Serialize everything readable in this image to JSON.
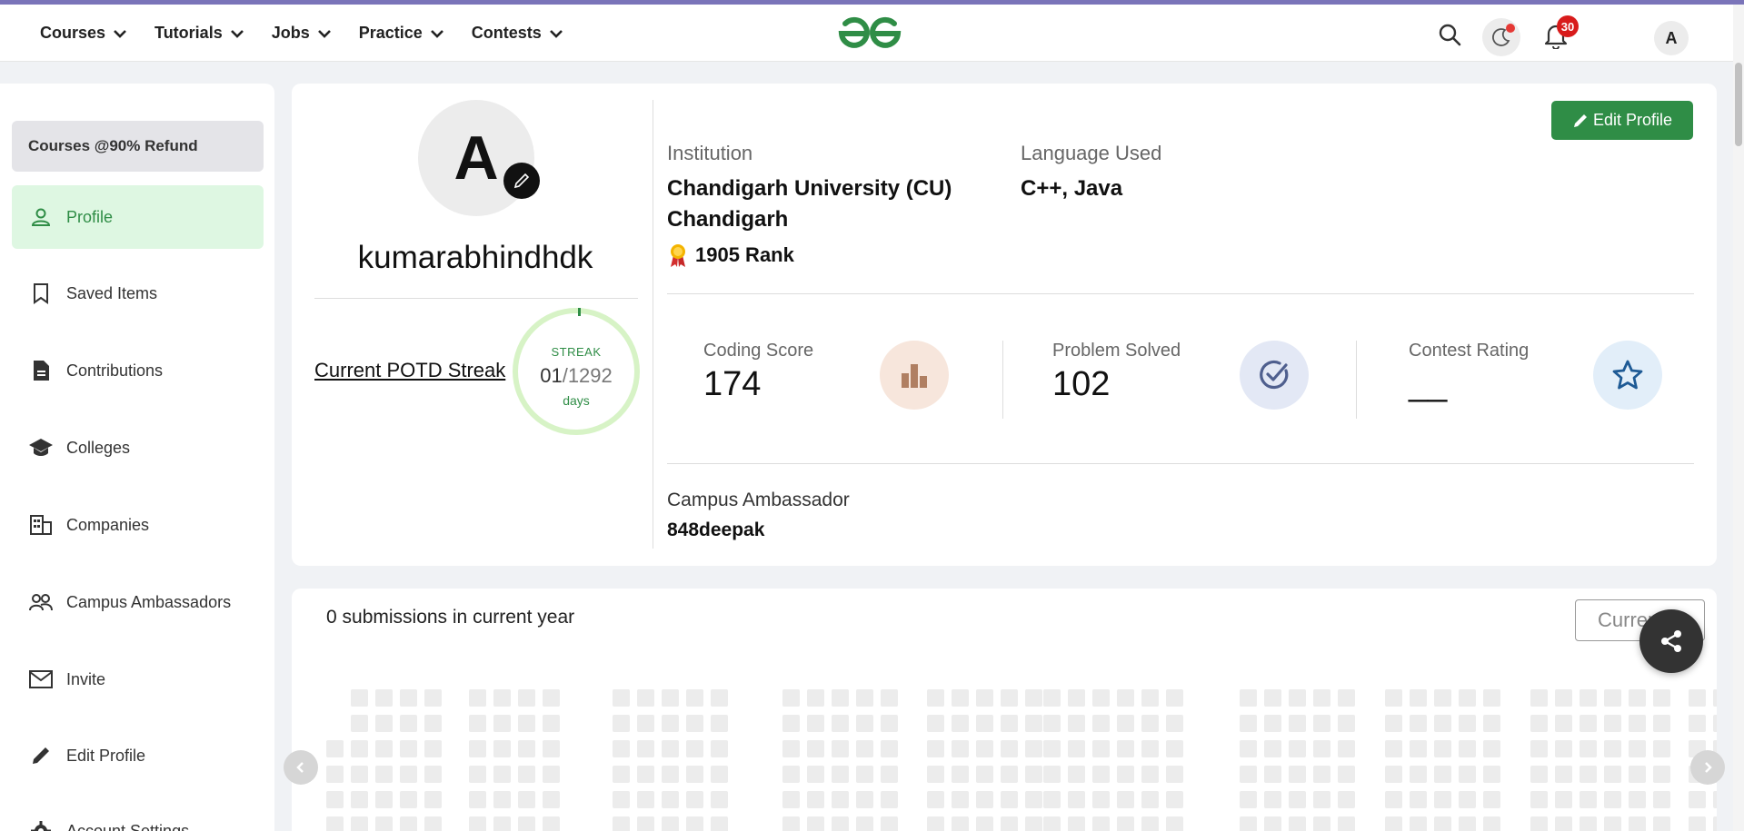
{
  "nav": {
    "menu": [
      {
        "label": "Courses"
      },
      {
        "label": "Tutorials"
      },
      {
        "label": "Jobs"
      },
      {
        "label": "Practice"
      },
      {
        "label": "Contests"
      }
    ],
    "notification_count": "30",
    "avatar_letter": "A"
  },
  "sidebar": {
    "refund_label": "Courses @90% Refund",
    "items": [
      {
        "label": "Profile",
        "icon": "person-icon",
        "active": true
      },
      {
        "label": "Saved Items",
        "icon": "bookmark-icon"
      },
      {
        "label": "Contributions",
        "icon": "document-icon"
      },
      {
        "label": "Colleges",
        "icon": "graduation-cap-icon"
      },
      {
        "label": "Companies",
        "icon": "building-icon"
      },
      {
        "label": "Campus Ambassadors",
        "icon": "group-icon"
      },
      {
        "label": "Invite",
        "icon": "mail-icon"
      },
      {
        "label": "Edit Profile",
        "icon": "pencil-icon"
      },
      {
        "label": "Account Settings",
        "icon": "gear-icon"
      }
    ]
  },
  "profile": {
    "avatar_letter": "A",
    "username": "kumarabhindhdk",
    "potd_link": "Current POTD Streak",
    "streak": {
      "label": "STREAK",
      "current": "01",
      "total": "/1292",
      "unit": "days"
    },
    "edit_button": "Edit Profile",
    "institution_label": "Institution",
    "institution_value": "Chandigarh University (CU) Chandigarh",
    "rank_value": "1905 Rank",
    "language_label": "Language Used",
    "language_value": "C++, Java",
    "stats": [
      {
        "label": "Coding Score",
        "value": "174",
        "icon": "bar-chart-icon"
      },
      {
        "label": "Problem Solved",
        "value": "102",
        "icon": "check-circle-icon"
      },
      {
        "label": "Contest Rating",
        "value": "__",
        "icon": "star-icon"
      }
    ],
    "campus_ambassador_label": "Campus Ambassador",
    "campus_ambassador_value": "848deepak"
  },
  "submissions": {
    "title": "0 submissions in current year",
    "year_select": "Current"
  },
  "colors": {
    "accent": "#2f8d46",
    "active_bg": "#def7e2",
    "badge": "#d81b1b"
  }
}
